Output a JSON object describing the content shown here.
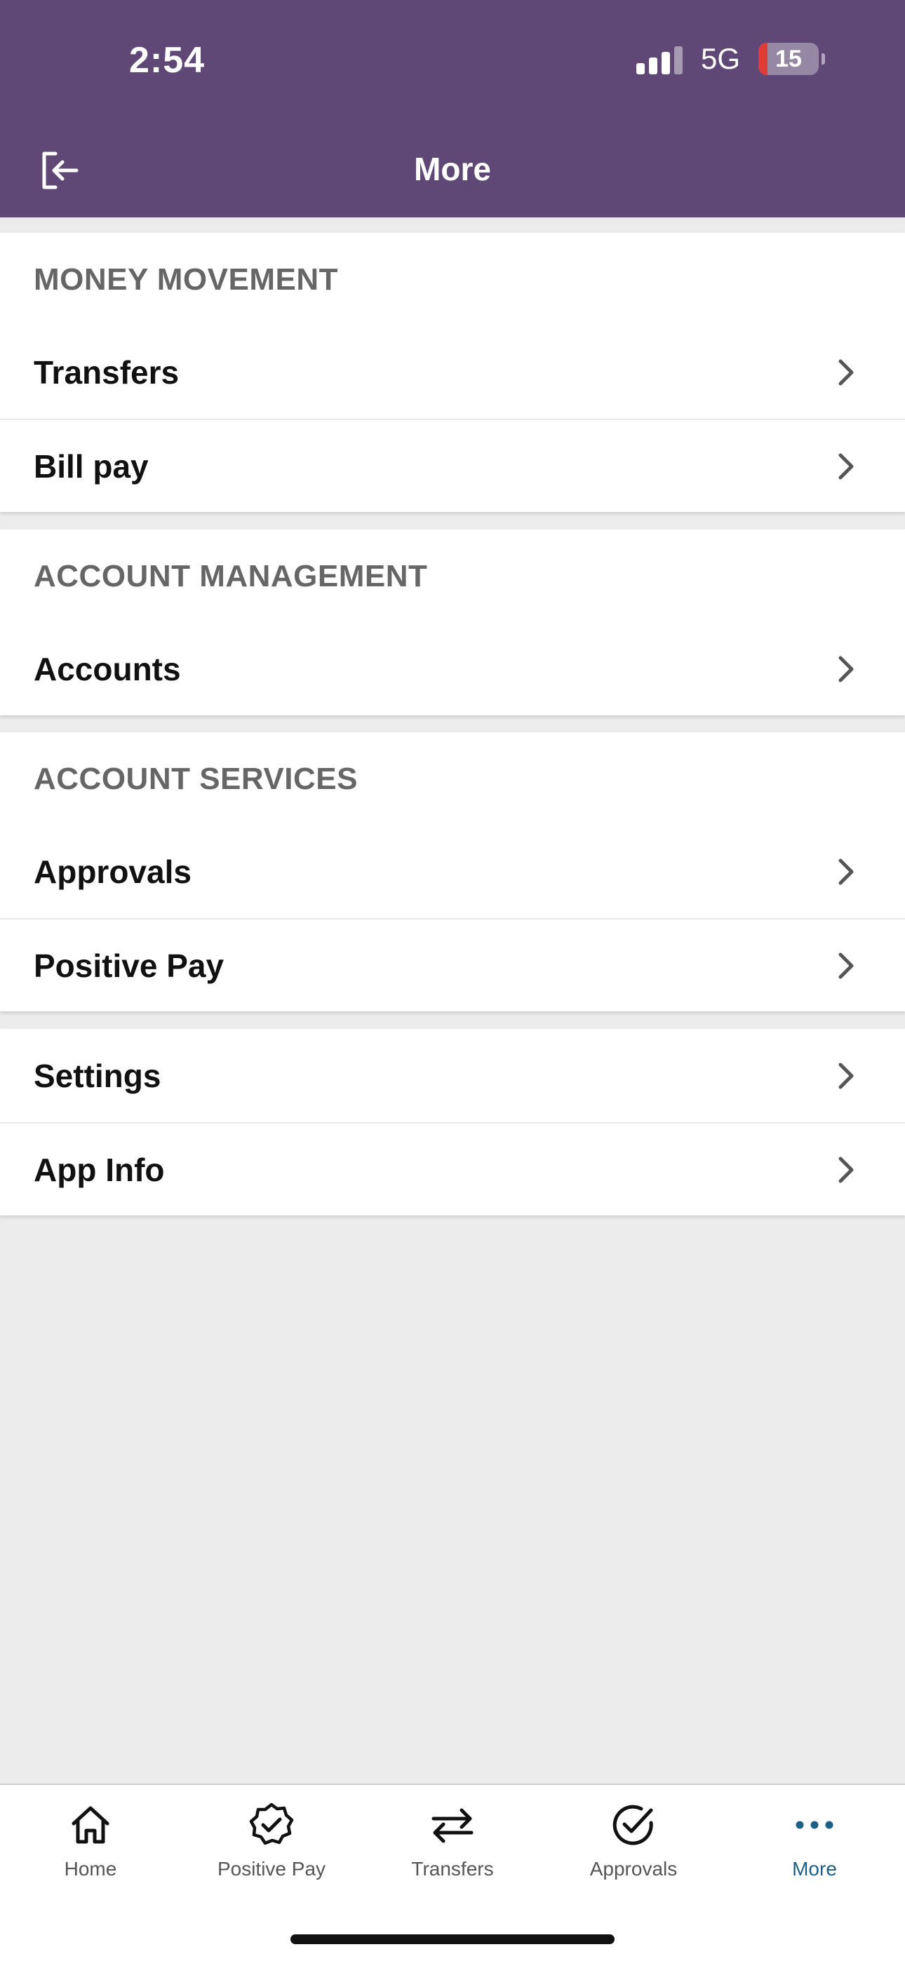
{
  "status_bar": {
    "time": "2:54",
    "network": "5G",
    "battery": "15",
    "battery_level": 0.15
  },
  "header": {
    "title": "More",
    "logout_icon": "logout-icon"
  },
  "sections": [
    {
      "title": "MONEY MOVEMENT",
      "items": [
        {
          "label": "Transfers"
        },
        {
          "label": "Bill pay"
        }
      ]
    },
    {
      "title": "ACCOUNT MANAGEMENT",
      "items": [
        {
          "label": "Accounts"
        }
      ]
    },
    {
      "title": "ACCOUNT SERVICES",
      "items": [
        {
          "label": "Approvals"
        },
        {
          "label": "Positive Pay"
        }
      ]
    },
    {
      "title": "",
      "items": [
        {
          "label": "Settings"
        },
        {
          "label": "App Info"
        }
      ]
    }
  ],
  "tabbar": {
    "tabs": [
      {
        "label": "Home",
        "icon": "home-icon"
      },
      {
        "label": "Positive Pay",
        "icon": "badge-check-icon"
      },
      {
        "label": "Transfers",
        "icon": "transfer-arrows-icon"
      },
      {
        "label": "Approvals",
        "icon": "circle-check-icon"
      },
      {
        "label": "More",
        "icon": "more-dots-icon",
        "active": true
      }
    ]
  },
  "colors": {
    "header_bg": "#5f4876",
    "active_tab": "#1d5f86",
    "battery_low": "#e03a3a"
  }
}
